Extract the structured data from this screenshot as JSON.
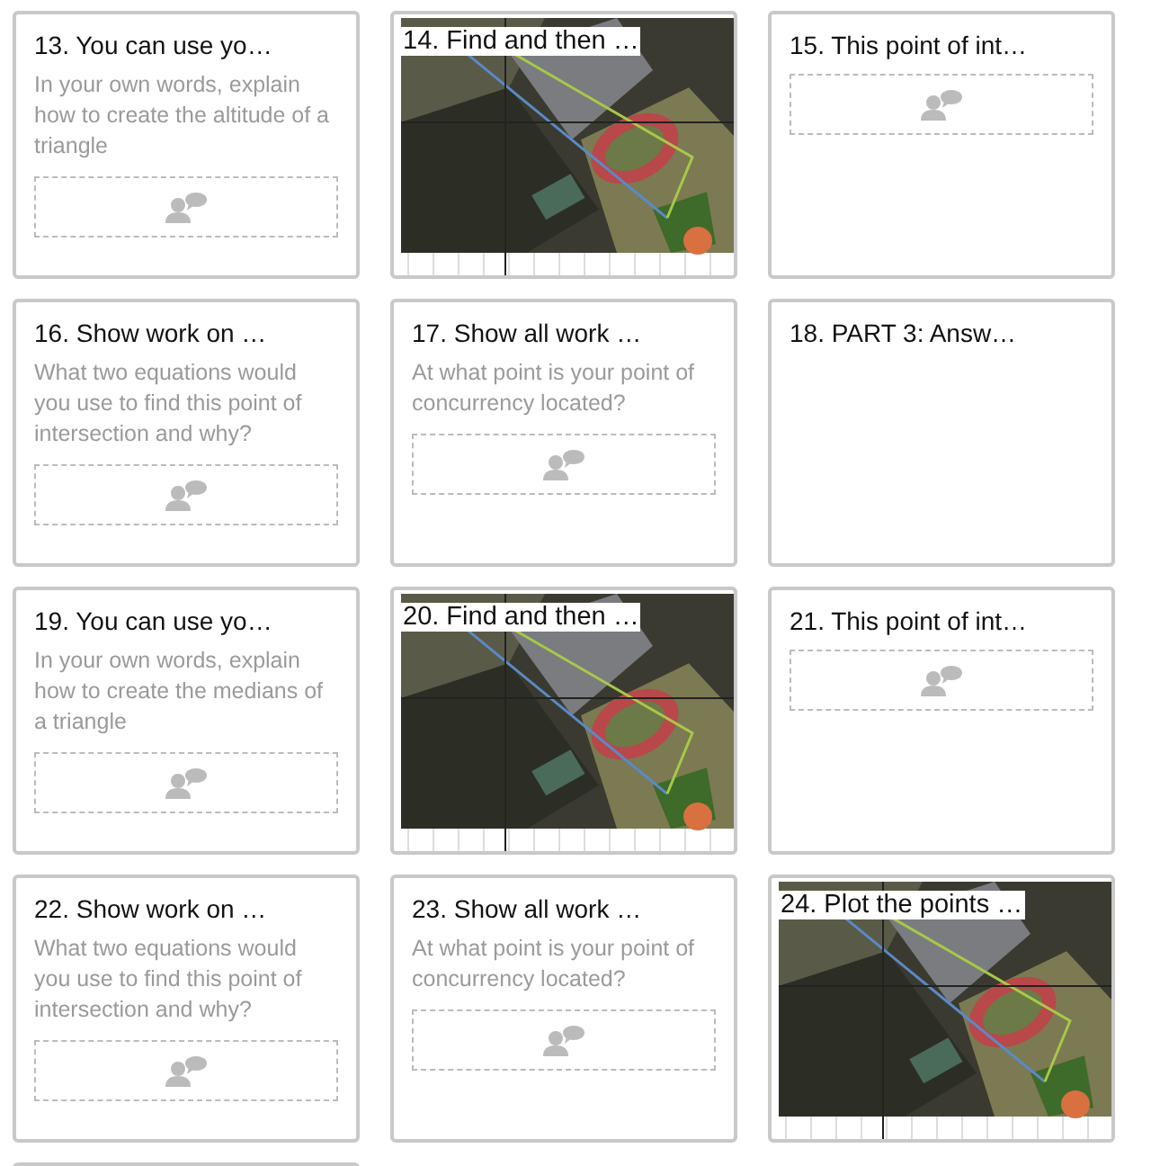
{
  "cards": [
    {
      "kind": "question",
      "title": "13. You can use yo…",
      "prompt": "In your own words, explain how to create the altitude of a triangle",
      "response": true
    },
    {
      "title": "14. Find and then …"
    },
    {
      "kind": "question",
      "title": "15. This point of int…",
      "response": true
    },
    {
      "kind": "question",
      "title": "16. Show work on …",
      "prompt": "What two equations would you use to find this point of intersection and why?",
      "response": true
    },
    {
      "kind": "question",
      "title": "17. Show all work …",
      "prompt": "At what point is your point of concurrency located?",
      "response": true
    },
    {
      "kind": "question",
      "title": "18. PART 3: Answ…",
      "response": false
    },
    {
      "kind": "question",
      "title": "19. You can use yo…",
      "prompt": "In your own words, explain how to create the medians of a triangle",
      "response": true
    },
    {
      "title": "20. Find and then …"
    },
    {
      "kind": "question",
      "title": "21. This point of int…",
      "response": true
    },
    {
      "kind": "question",
      "title": "22. Show work on …",
      "prompt": "What two equations would you use to find this point of intersection and why?",
      "response": true
    },
    {
      "kind": "question",
      "title": "23. Show all work …",
      "prompt": "At what point is your point of concurrency located?",
      "response": true
    },
    {
      "title": "24. Plot the points …"
    }
  ]
}
